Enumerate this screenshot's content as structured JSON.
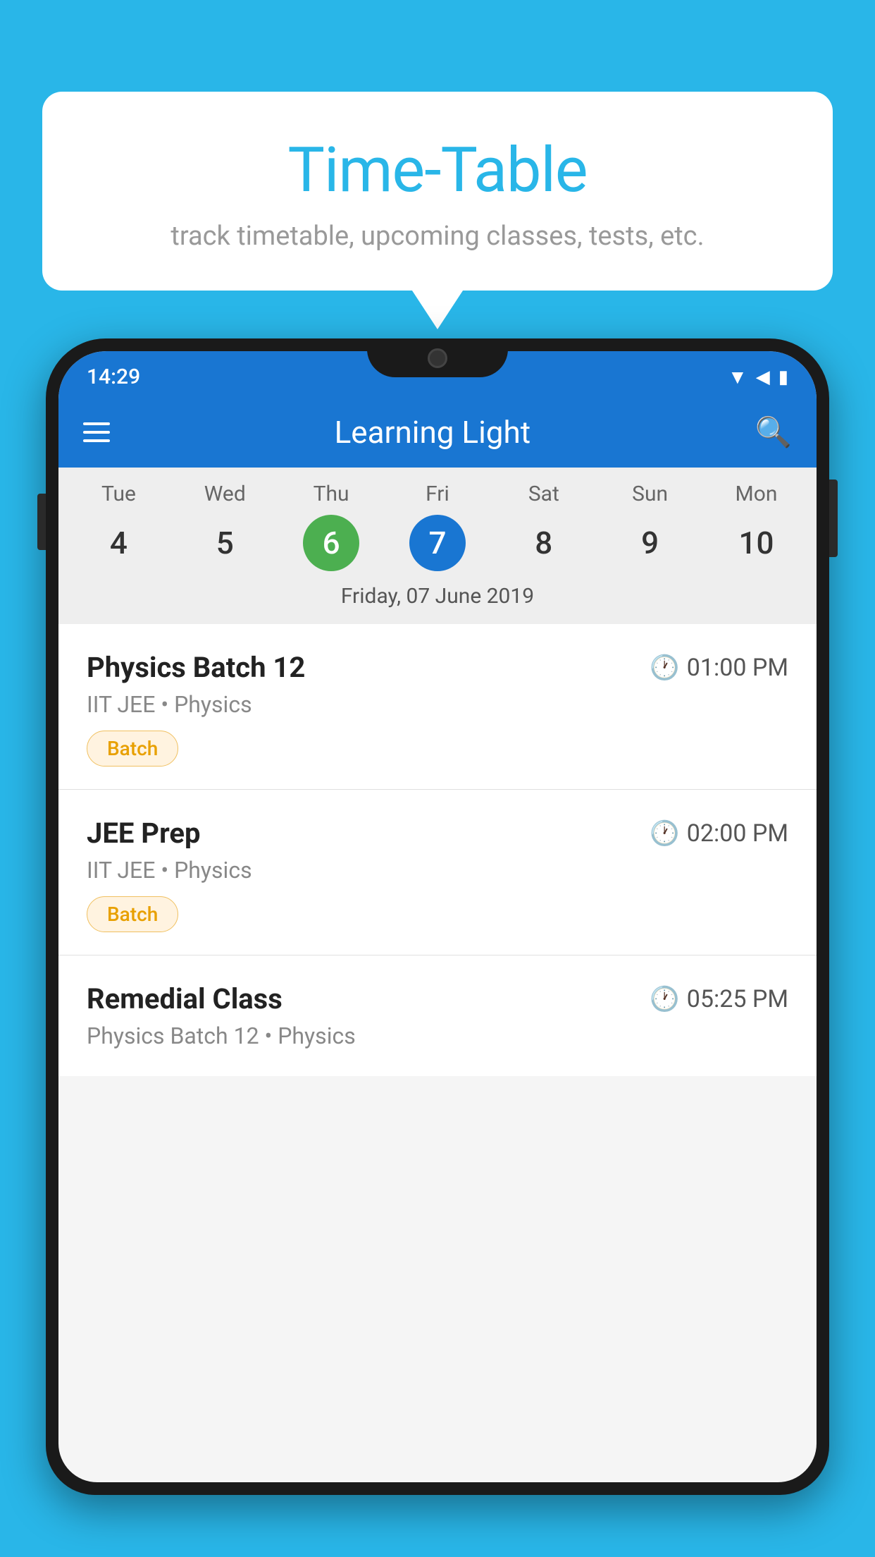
{
  "background_color": "#29B6E8",
  "bubble": {
    "title": "Time-Table",
    "subtitle": "track timetable, upcoming classes, tests, etc."
  },
  "status_bar": {
    "time": "14:29"
  },
  "app_bar": {
    "title": "Learning Light"
  },
  "calendar": {
    "days": [
      {
        "label": "Tue",
        "num": "4",
        "state": "normal"
      },
      {
        "label": "Wed",
        "num": "5",
        "state": "normal"
      },
      {
        "label": "Thu",
        "num": "6",
        "state": "today"
      },
      {
        "label": "Fri",
        "num": "7",
        "state": "selected"
      },
      {
        "label": "Sat",
        "num": "8",
        "state": "normal"
      },
      {
        "label": "Sun",
        "num": "9",
        "state": "normal"
      },
      {
        "label": "Mon",
        "num": "10",
        "state": "normal"
      }
    ],
    "selected_date_label": "Friday, 07 June 2019"
  },
  "schedule": [
    {
      "title": "Physics Batch 12",
      "time": "01:00 PM",
      "subtitle": "IIT JEE • Physics",
      "tag": "Batch"
    },
    {
      "title": "JEE Prep",
      "time": "02:00 PM",
      "subtitle": "IIT JEE • Physics",
      "tag": "Batch"
    },
    {
      "title": "Remedial Class",
      "time": "05:25 PM",
      "subtitle": "Physics Batch 12 • Physics",
      "tag": null
    }
  ]
}
